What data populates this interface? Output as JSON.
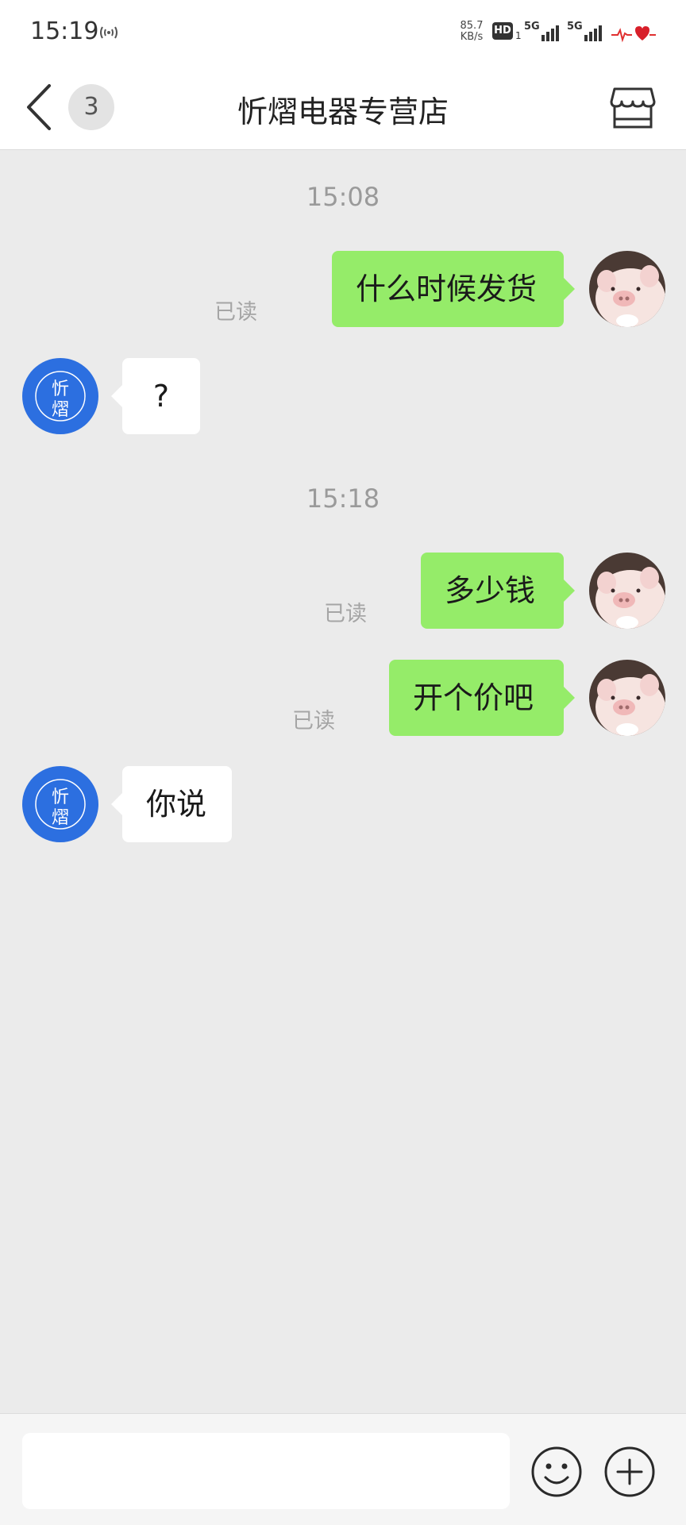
{
  "status_bar": {
    "time": "15:19",
    "nfc_icon": "nfc-icon",
    "net_speed_value": "85.7",
    "net_speed_unit": "KB/s",
    "hd_label": "HD",
    "hd_sub": "1",
    "signal1_label": "5G",
    "signal2_label": "5G",
    "battery_icon": "heart-battery-icon"
  },
  "header": {
    "back_icon": "chevron-left-icon",
    "unread_count": "3",
    "title": "忻熠电器专营店",
    "store_icon": "storefront-icon"
  },
  "messages": [
    {
      "type": "timestamp",
      "text": "15:08"
    },
    {
      "type": "out",
      "text": "什么时候发货",
      "read": "已读"
    },
    {
      "type": "in",
      "text": "?"
    },
    {
      "type": "timestamp",
      "text": "15:18"
    },
    {
      "type": "out",
      "text": "多少钱",
      "read": "已读"
    },
    {
      "type": "out",
      "text": "开个价吧",
      "read": "已读"
    },
    {
      "type": "in",
      "text": "你说"
    }
  ],
  "store_avatar": {
    "line1": "忻",
    "line2": "熠",
    "color": "#2c6fe0"
  },
  "colors": {
    "outgoing_bubble": "#95ec69",
    "incoming_bubble": "#ffffff",
    "chat_background": "#ebebeb"
  },
  "input_bar": {
    "placeholder": "",
    "emoji_icon": "smiley-icon",
    "plus_icon": "plus-circle-icon"
  }
}
